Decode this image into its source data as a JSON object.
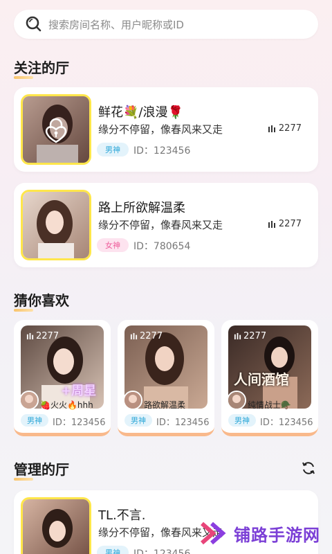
{
  "search": {
    "placeholder": "搜索房间名称、用户昵称或ID"
  },
  "sections": {
    "followed": "关注的厅",
    "recommended": "猜你喜欢",
    "managed": "管理的厅"
  },
  "followed_rooms": [
    {
      "title": "鲜花💐/浪漫🌹",
      "desc": "缘分不停留，像春风来又走",
      "count": "2277",
      "tag": "男神",
      "id": "ID：123456",
      "locked": true
    },
    {
      "title": "路上所欲解温柔",
      "desc": "缘分不停留，像春风来又走",
      "count": "2277",
      "tag": "女神",
      "id": "ID：780654",
      "locked": false
    }
  ],
  "recommended_rooms": [
    {
      "count": "2277",
      "overlay": "+周星",
      "name": "🍓火火🔥hhh",
      "tag": "男神",
      "id": "ID：123456"
    },
    {
      "count": "2277",
      "overlay": "",
      "name": "路欲解温柔",
      "tag": "男神",
      "id": "ID：123456"
    },
    {
      "count": "2277",
      "overlay": "人间酒馆",
      "name": "纯情战士🪖",
      "tag": "男神",
      "id": "ID：123456"
    }
  ],
  "managed_rooms": [
    {
      "title": "TL.不言.",
      "desc": "缘分不停留，像春风来又走",
      "tag": "男神",
      "id": "ID：123456"
    }
  ],
  "watermark": "铺路手游网",
  "colors": {
    "accent_yellow": "#ffe64a",
    "male_tag": "#2fa8d8",
    "female_tag": "#ee5f9c"
  }
}
